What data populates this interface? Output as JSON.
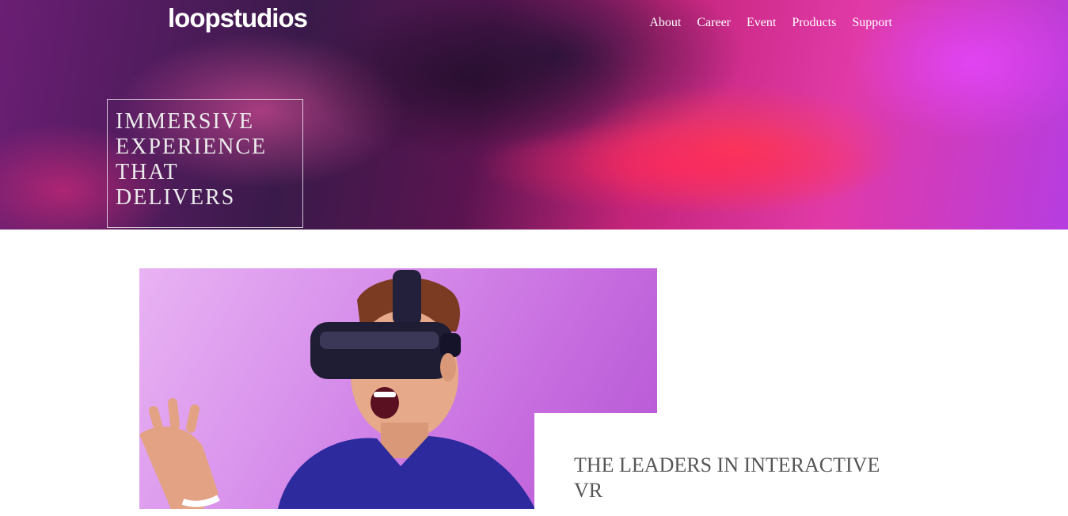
{
  "header": {
    "logo_text": "loopstudios",
    "nav": [
      "About",
      "Career",
      "Event",
      "Products",
      "Support"
    ]
  },
  "hero": {
    "headline_lines": [
      "IMMERSIVE",
      "EXPERIENCE",
      "THAT",
      "DELIVERS"
    ]
  },
  "feature": {
    "title": "THE LEADERS IN INTERACTIVE VR"
  },
  "colors": {
    "hero_magenta": "#e13aa8",
    "hero_purple": "#6b1e74",
    "image_background": "#d892ec",
    "shirt_blue": "#2d2a9e",
    "title_text": "#555555"
  }
}
